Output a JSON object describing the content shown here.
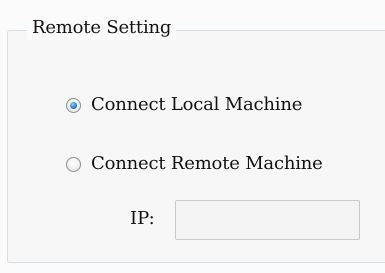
{
  "group": {
    "title": "Remote Setting"
  },
  "options": {
    "local": {
      "label": "Connect Local Machine",
      "selected": true
    },
    "remote": {
      "label": "Connect Remote Machine",
      "selected": false
    }
  },
  "ip": {
    "label": "IP:",
    "value": ""
  },
  "colors": {
    "radio_selected": "#2b7fc9",
    "group_border": "#d5dfe5"
  }
}
